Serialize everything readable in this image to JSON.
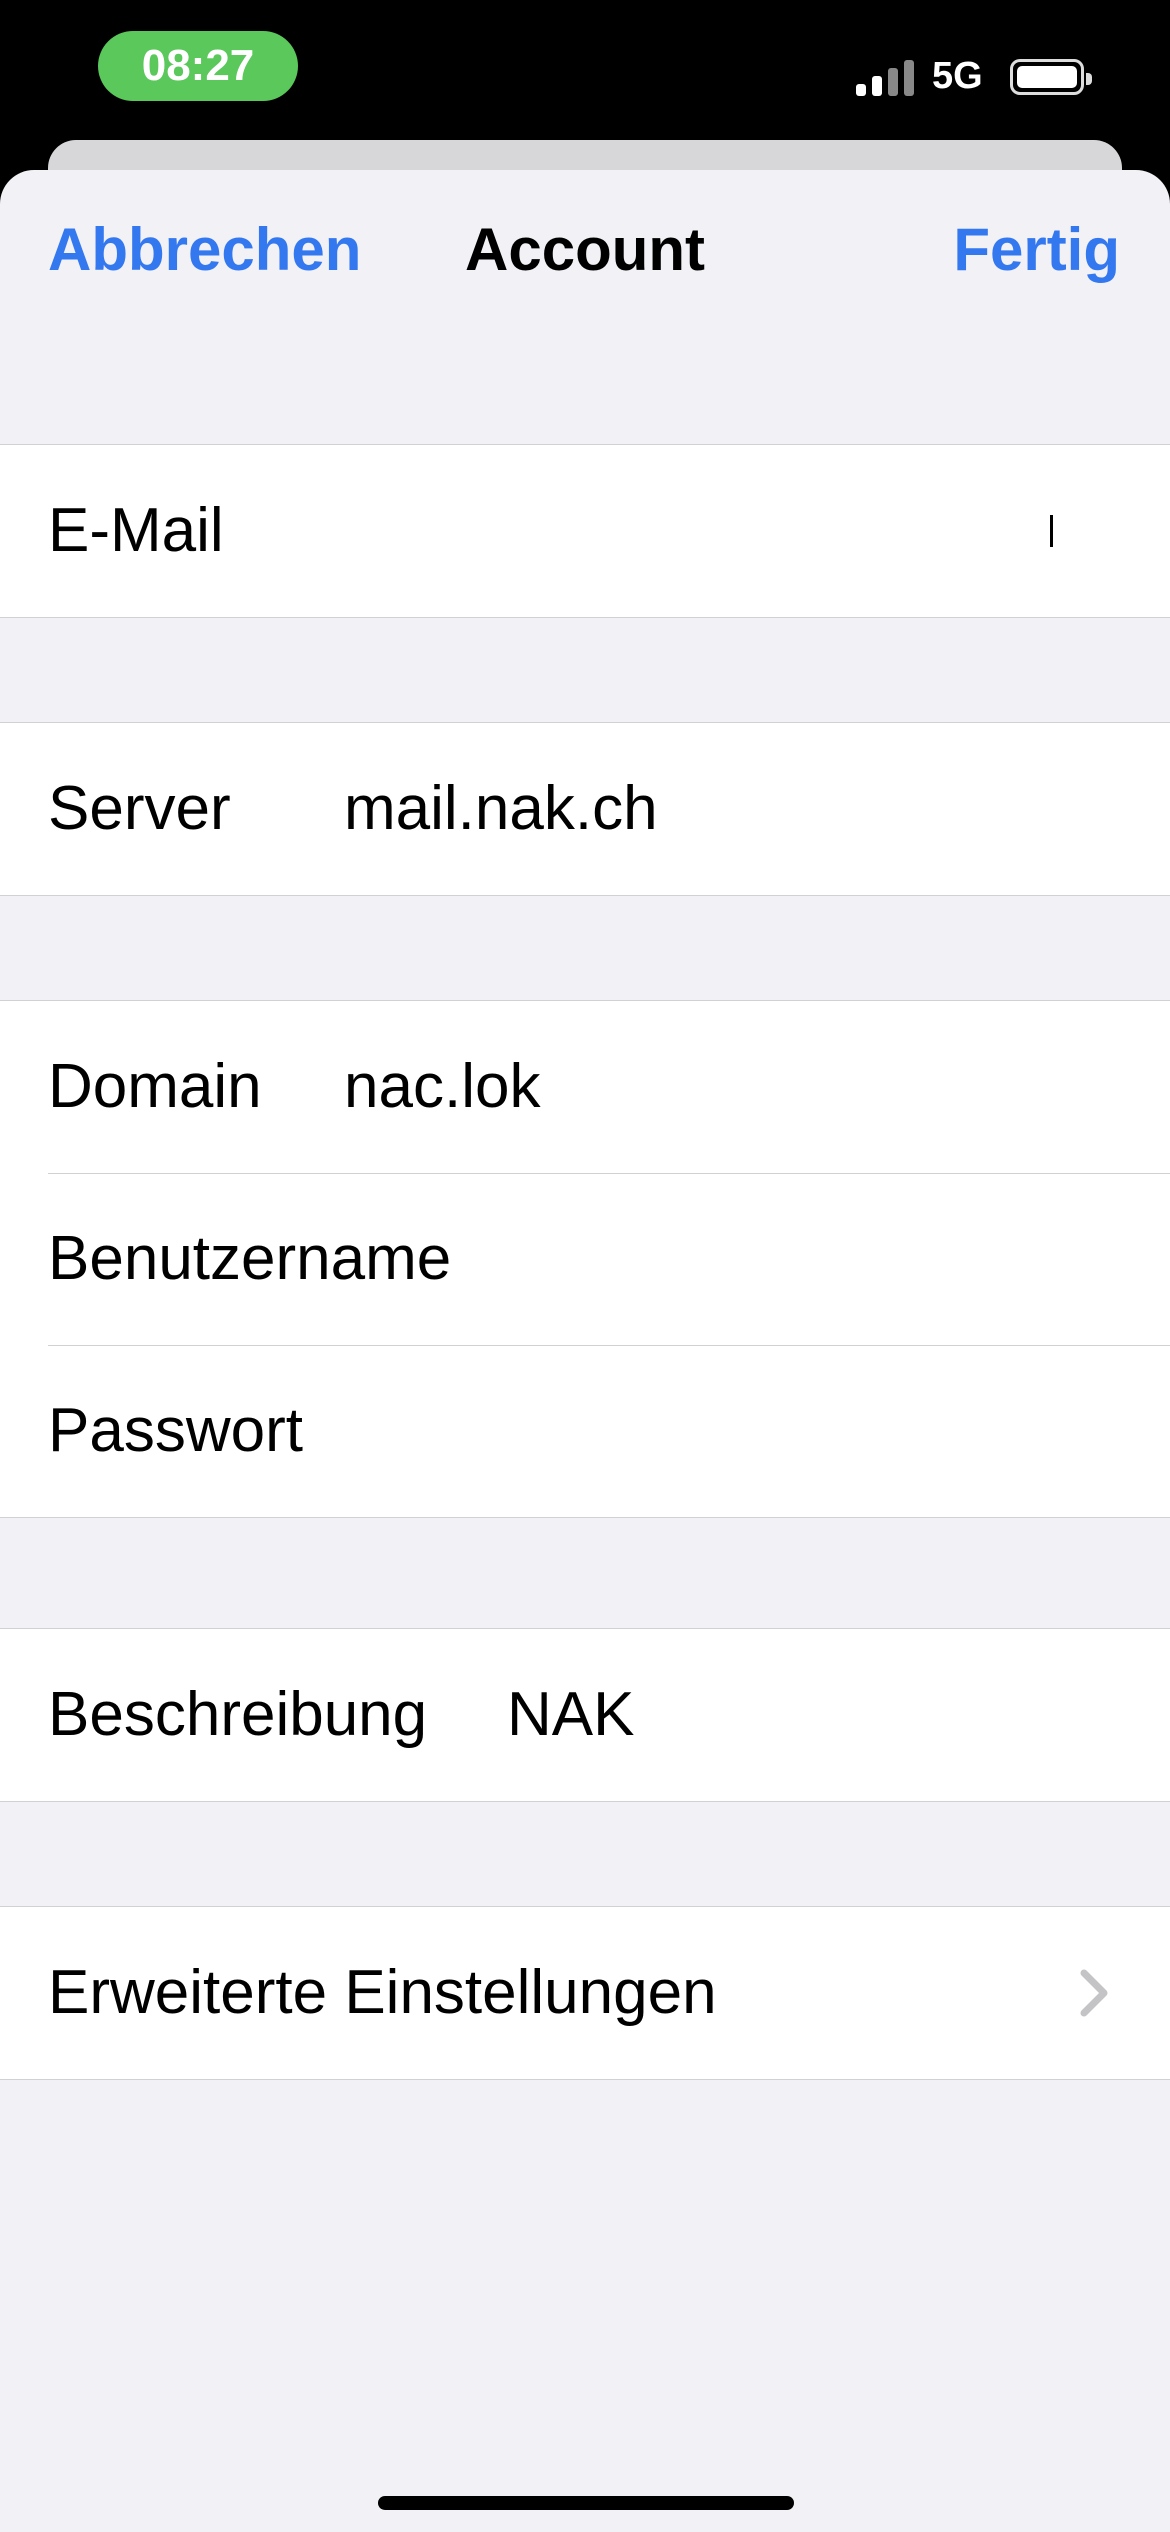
{
  "status_bar": {
    "time": "08:27",
    "network": "5G"
  },
  "nav": {
    "cancel_label": "Abbrechen",
    "title": "Account",
    "done_label": "Fertig"
  },
  "fields": {
    "email": {
      "label": "E-Mail",
      "value": ""
    },
    "server": {
      "label": "Server",
      "value": "mail.nak.ch"
    },
    "domain": {
      "label": "Domain",
      "value": "nac.lok"
    },
    "username": {
      "label": "Benutzername",
      "value": ""
    },
    "password": {
      "label": "Passwort",
      "value": ""
    },
    "description": {
      "label": "Beschreibung",
      "value": "NAK"
    }
  },
  "advanced": {
    "label": "Erweiterte Einstellungen",
    "icon": "chevron-right-icon"
  },
  "colors": {
    "accent": "#3478f0",
    "time_pill": "#5ac85a",
    "background": "#f1f1f6"
  }
}
